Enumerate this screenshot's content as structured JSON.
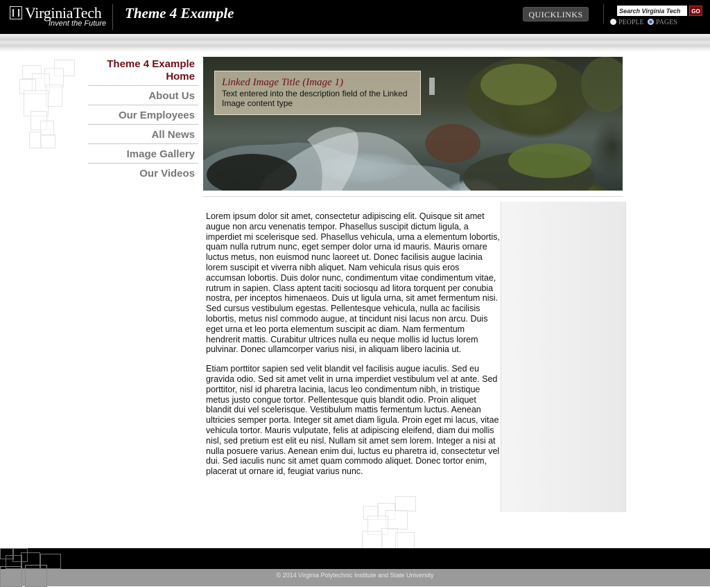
{
  "header": {
    "logo_wordmark": "VirginiaTech",
    "logo_tagline": "Invent the Future",
    "site_title": "Theme 4 Example",
    "quicklinks_label": "QUICKLINKS",
    "search": {
      "placeholder": "Search Virginia Tech",
      "go_label": "GO"
    },
    "search_scope": {
      "people_label": "PEOPLE",
      "pages_label": "PAGES",
      "selected": "PAGES"
    }
  },
  "nav": {
    "items": [
      {
        "label": "Theme 4 Example Home",
        "current": true
      },
      {
        "label": "About Us"
      },
      {
        "label": "Our Employees"
      },
      {
        "label": "All News"
      },
      {
        "label": "Image Gallery"
      },
      {
        "label": "Our Videos"
      }
    ]
  },
  "banner": {
    "title": "Linked Image Title (Image 1)",
    "description": "Text entered into the description field of the Linked Image content type"
  },
  "content": {
    "paragraphs": [
      "Lorem ipsum dolor sit amet, consectetur adipiscing elit. Quisque sit amet augue non arcu venenatis tempor. Phasellus suscipit dictum ligula, a imperdiet mi scelerisque sed. Phasellus vehicula, urna a elementum lobortis, quam nulla rutrum nunc, eget semper dolor urna id mauris. Mauris ornare luctus metus, non euismod nunc laoreet ut. Donec facilisis augue lacinia lorem suscipit et viverra nibh aliquet. Nam vehicula risus quis eros accumsan lobortis. Duis dolor nunc, condimentum vitae condimentum vitae, rutrum in sapien. Class aptent taciti sociosqu ad litora torquent per conubia nostra, per inceptos himenaeos. Duis ut ligula urna, sit amet fermentum nisi. Sed cursus vestibulum egestas. Pellentesque vehicula, nulla ac facilisis lobortis, metus nisl commodo augue, at tincidunt nisi lacus non arcu. Duis eget urna et leo porta elementum suscipit ac diam. Nam fermentum hendrerit mattis. Curabitur ultrices nulla eu neque mollis id luctus lorem pulvinar. Donec ullamcorper varius nisi, in aliquam libero lacinia ut.",
      "Etiam porttitor sapien sed velit blandit vel facilisis augue iaculis. Sed eu gravida odio. Sed sit amet velit in urna imperdiet vestibulum vel at ante. Sed porttitor, nisl id pharetra lacinia, lacus leo condimentum nibh, in tristique metus justo congue tortor. Pellentesque quis blandit odio. Proin aliquet blandit dui vel scelerisque. Vestibulum mattis fermentum luctus. Aenean ultricies semper porta. Integer sit amet diam ligula. Proin eget mi lacus, vitae vehicula tortor. Mauris vulputate, felis at adipiscing eleifend, diam dui mollis nisl, sed pretium est elit eu nisl. Nullam sit amet sem lorem. Integer a nisi at nulla posuere varius. Aenean enim dui, luctus eu pharetra id, consectetur vel dui. Sed iaculis nunc sit amet quam commodo aliquet. Donec tortor enim, placerat ut ornare id, feugiat varius nunc."
    ]
  },
  "footer": {
    "copyright": "© 2014 Virginia Polytechnic Institute and State University"
  },
  "colors": {
    "header_bg": "#000000",
    "brand_maroon": "#6e0f16",
    "go_button": "#7a0b0b",
    "nav_text": "#777777",
    "footer_gray": "#9a9a9a"
  },
  "icons": [
    "shield-logo-icon",
    "radio-people-icon",
    "radio-pages-icon"
  ]
}
